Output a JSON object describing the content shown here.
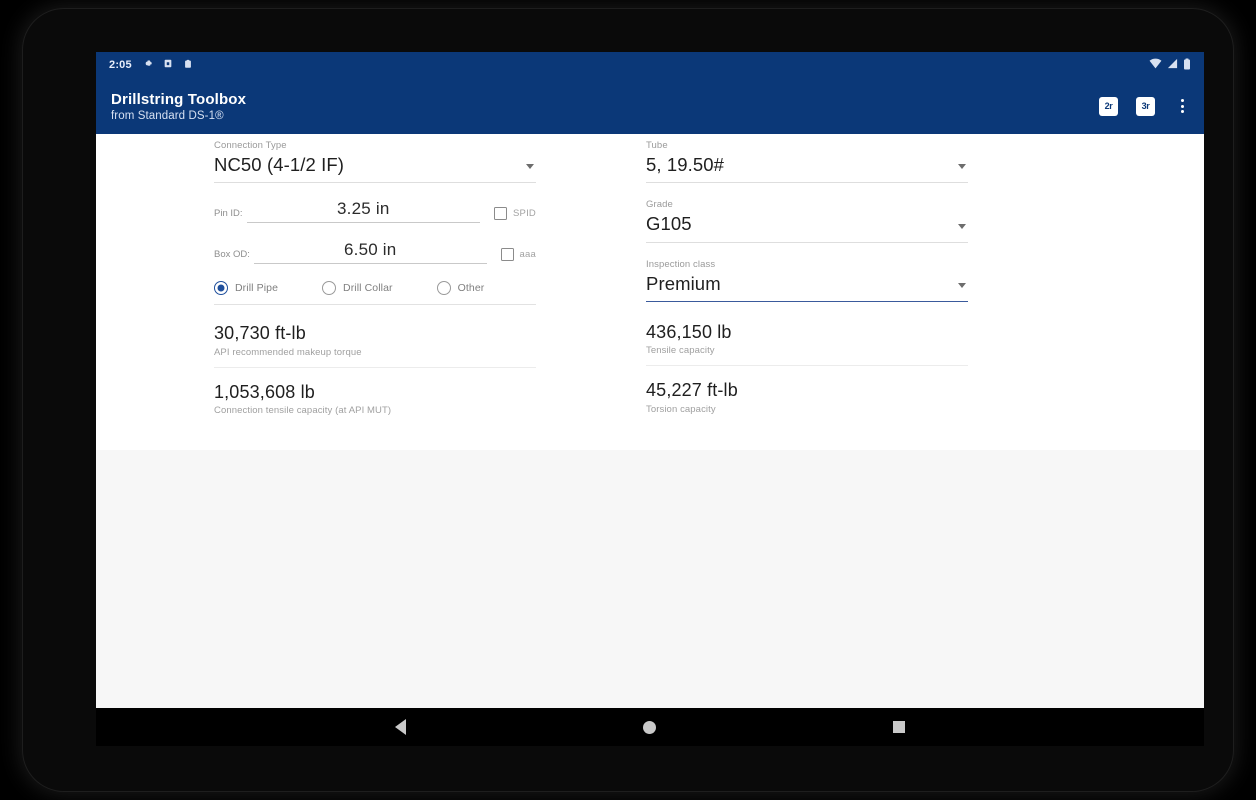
{
  "status_bar": {
    "time": "2:05",
    "left_icons": [
      "settings-gear-icon",
      "app-notification-icon",
      "clipboard-icon"
    ],
    "right_icons": [
      "wifi-icon",
      "cellular-signal-icon",
      "battery-icon"
    ]
  },
  "app_bar": {
    "title": "Drillstring Toolbox",
    "subtitle": "from Standard DS-1®",
    "actions": [
      {
        "name": "unit-toggle-button",
        "glyph": "2r"
      },
      {
        "name": "secondary-action-button",
        "glyph": "3r"
      }
    ],
    "overflow_label": "More options",
    "background": "#0b3878"
  },
  "connection": {
    "type_label": "Connection Type",
    "type_value": "NC50 (4-1/2 IF)",
    "pin_id_label": "Pin ID:",
    "pin_id_value": "3.25 in",
    "pin_id_check_label": "SPID",
    "box_od_label": "Box OD:",
    "box_od_value": "6.50 in",
    "box_od_check_label": "aaa",
    "component_options": [
      {
        "label": "Drill Pipe",
        "selected": true
      },
      {
        "label": "Drill Collar",
        "selected": false
      },
      {
        "label": "Other",
        "selected": false
      }
    ],
    "results": [
      {
        "value": "30,730 ft-lb",
        "caption": "API recommended makeup torque"
      },
      {
        "value": "1,053,608 lb",
        "caption": "Connection tensile capacity (at API MUT)"
      }
    ]
  },
  "tube": {
    "tube_label": "Tube",
    "tube_value": "5, 19.50#",
    "grade_label": "Grade",
    "grade_value": "G105",
    "inspection_label": "Inspection class",
    "inspection_value": "Premium",
    "results": [
      {
        "value": "436,150 lb",
        "caption": "Tensile capacity"
      },
      {
        "value": "45,227 ft-lb",
        "caption": "Torsion capacity"
      }
    ]
  },
  "nav_bar": {
    "back": "back-icon",
    "home": "home-icon",
    "recents": "recents-icon"
  },
  "colors": {
    "primary": "#0b3878",
    "accent": "#1f4f9c",
    "surface": "#ffffff",
    "background": "#f7f7f7"
  }
}
